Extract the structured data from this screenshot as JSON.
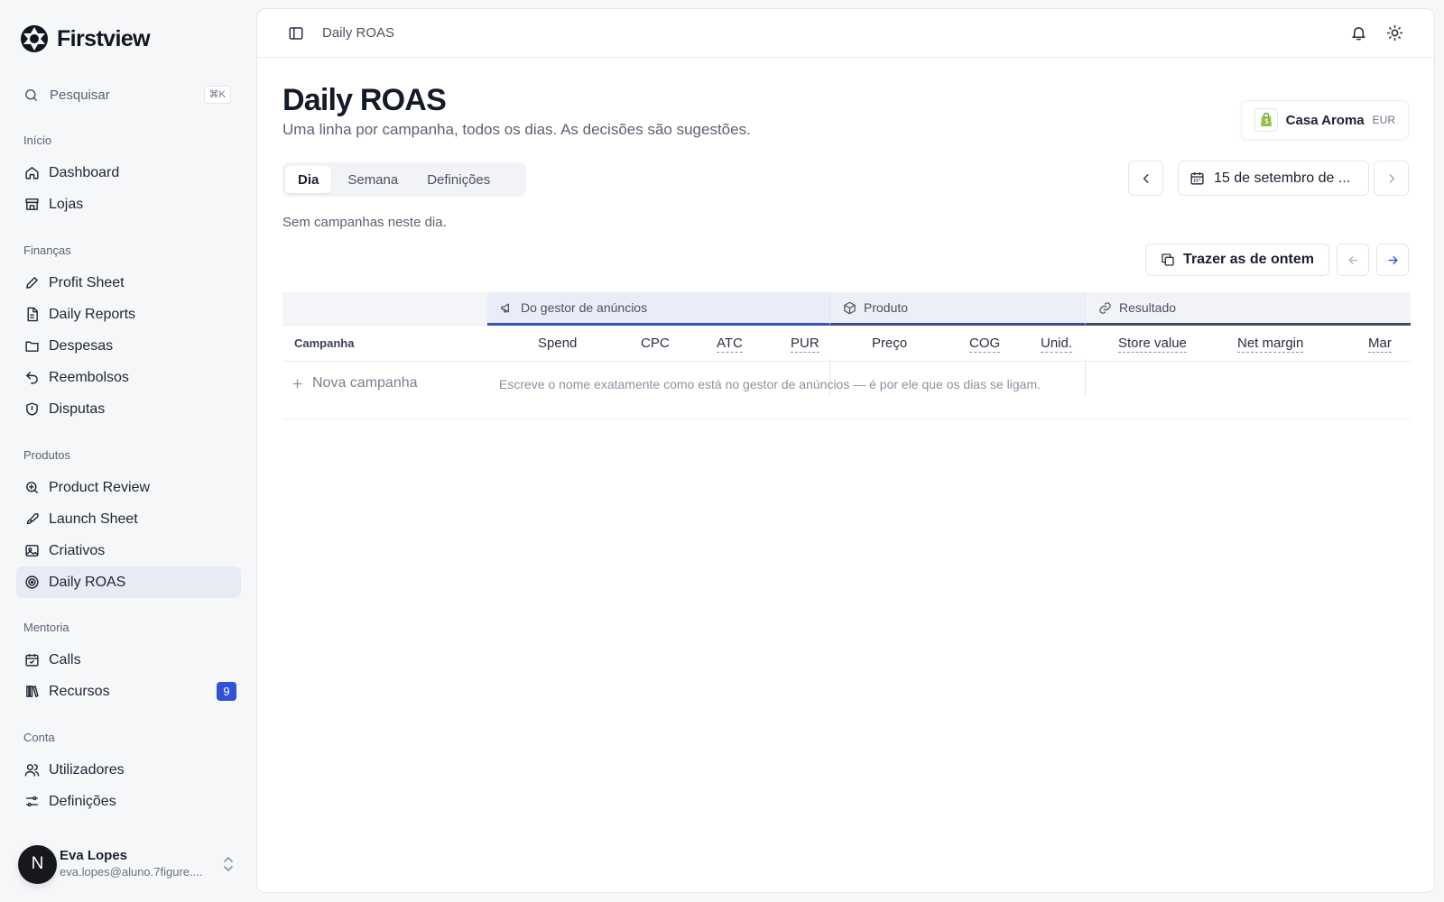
{
  "app": {
    "name": "Firstview"
  },
  "search": {
    "label": "Pesquisar",
    "shortcut": "⌘K"
  },
  "sidebar": {
    "sections": [
      {
        "label": "Início",
        "items": [
          {
            "label": "Dashboard",
            "icon": "home-icon"
          },
          {
            "label": "Lojas",
            "icon": "store-icon"
          }
        ]
      },
      {
        "label": "Finanças",
        "items": [
          {
            "label": "Profit Sheet",
            "icon": "pencil-icon"
          },
          {
            "label": "Daily Reports",
            "icon": "file-icon"
          },
          {
            "label": "Despesas",
            "icon": "folder-icon"
          },
          {
            "label": "Reembolsos",
            "icon": "undo-icon"
          },
          {
            "label": "Disputas",
            "icon": "shield-icon"
          }
        ]
      },
      {
        "label": "Produtos",
        "items": [
          {
            "label": "Product Review",
            "icon": "search-zoom-icon"
          },
          {
            "label": "Launch Sheet",
            "icon": "rocket-icon"
          },
          {
            "label": "Criativos",
            "icon": "image-icon"
          },
          {
            "label": "Daily ROAS",
            "icon": "target-icon",
            "active": true
          }
        ]
      },
      {
        "label": "Mentoria",
        "items": [
          {
            "label": "Calls",
            "icon": "calendar-icon"
          },
          {
            "label": "Recursos",
            "icon": "library-icon",
            "badge": "9"
          }
        ]
      },
      {
        "label": "Conta",
        "items": [
          {
            "label": "Utilizadores",
            "icon": "users-icon"
          },
          {
            "label": "Definições",
            "icon": "sliders-icon"
          }
        ]
      }
    ]
  },
  "user": {
    "initial": "N",
    "name": "Eva Lopes",
    "email": "eva.lopes@aluno.7figure...."
  },
  "topbar": {
    "breadcrumb": "Daily ROAS"
  },
  "page": {
    "title": "Daily ROAS",
    "subtitle": "Uma linha por campanha, todos os dias. As decisões são sugestões.",
    "store": {
      "name": "Casa Aroma",
      "currency": "EUR"
    },
    "tabs": [
      {
        "label": "Dia",
        "active": true
      },
      {
        "label": "Semana"
      },
      {
        "label": "Definições"
      }
    ],
    "date": "15 de setembro de ...",
    "empty_message": "Sem campanhas neste dia.",
    "copy_button": "Trazer as de ontem"
  },
  "table": {
    "groups": {
      "ads": "Do gestor de anúncios",
      "product": "Produto",
      "result": "Resultado"
    },
    "columns": {
      "campaign": "Campanha",
      "spend": "Spend",
      "cpc": "CPC",
      "atc": "ATC",
      "pur": "PUR",
      "price": "Preço",
      "cog": "COG",
      "units": "Unid.",
      "store_value": "Store value",
      "net_margin": "Net margin",
      "margin_cut": "Mar"
    },
    "new_row": {
      "label": "Nova campanha",
      "hint": "Escreve o nome exatamente como está no gestor de anúncios — é por ele que os dias se ligam."
    }
  },
  "colors": {
    "accent": "#3152d6",
    "active_nav": "#e8ebf4",
    "shopify": "#95bf47"
  }
}
